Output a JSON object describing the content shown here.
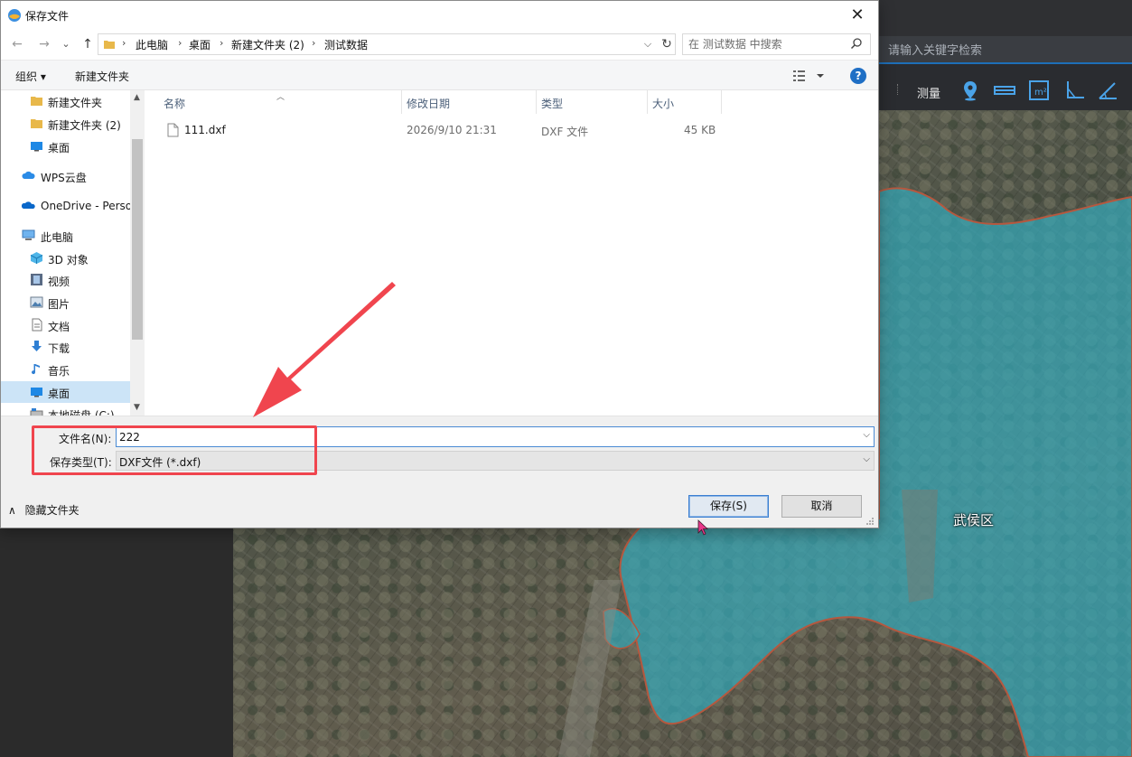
{
  "dialog": {
    "title": "保存文件",
    "close": "✕"
  },
  "nav": {
    "back": "←",
    "forward": "→",
    "history": "⌄",
    "up": "↑",
    "breadcrumb": [
      "此电脑",
      "桌面",
      "新建文件夹 (2)",
      "测试数据"
    ],
    "search_placeholder": "在 测试数据 中搜索"
  },
  "cmdbar": {
    "organize": "组织 ▾",
    "new_folder": "新建文件夹",
    "help": "?"
  },
  "sidebar": {
    "items": [
      {
        "label": "新建文件夹",
        "icon": "folder-icon"
      },
      {
        "label": "新建文件夹 (2)",
        "icon": "folder-icon"
      },
      {
        "label": "桌面",
        "icon": "desktop-icon"
      },
      {
        "label": "WPS云盘",
        "icon": "cloud-icon"
      },
      {
        "label": "OneDrive - Perso",
        "icon": "onedrive-icon"
      },
      {
        "label": "此电脑",
        "icon": "computer-icon"
      },
      {
        "label": "3D 对象",
        "icon": "cube-icon"
      },
      {
        "label": "视频",
        "icon": "video-icon"
      },
      {
        "label": "图片",
        "icon": "picture-icon"
      },
      {
        "label": "文档",
        "icon": "document-icon"
      },
      {
        "label": "下载",
        "icon": "download-icon"
      },
      {
        "label": "音乐",
        "icon": "music-icon"
      },
      {
        "label": "桌面",
        "icon": "desktop-icon"
      },
      {
        "label": "本地磁盘 (C:)",
        "icon": "drive-icon"
      }
    ]
  },
  "files": {
    "columns": [
      "名称",
      "修改日期",
      "类型",
      "大小"
    ],
    "rows": [
      {
        "name": "111.dxf",
        "date": "2026/9/10 21:31",
        "type": "DXF 文件",
        "size": "45 KB"
      }
    ]
  },
  "form": {
    "filename_label": "文件名(N):",
    "filename_value": "222",
    "filetype_label": "保存类型(T):",
    "filetype_value": "DXF文件 (*.dxf)",
    "hide_folders": "隐藏文件夹",
    "save": "保存(S)",
    "cancel": "取消"
  },
  "app": {
    "search_placeholder": "请输入关键字检索",
    "measure_label": "测量",
    "toolbar_icons": [
      "location-pin-icon",
      "ruler-icon",
      "area-icon",
      "angle-icon",
      "triangle-measure-icon"
    ],
    "district_label": "武侯区"
  },
  "colors": {
    "accent": "#1f6fc5",
    "highlight_red": "#f0454e",
    "map_overlay": "#35a8b8"
  }
}
